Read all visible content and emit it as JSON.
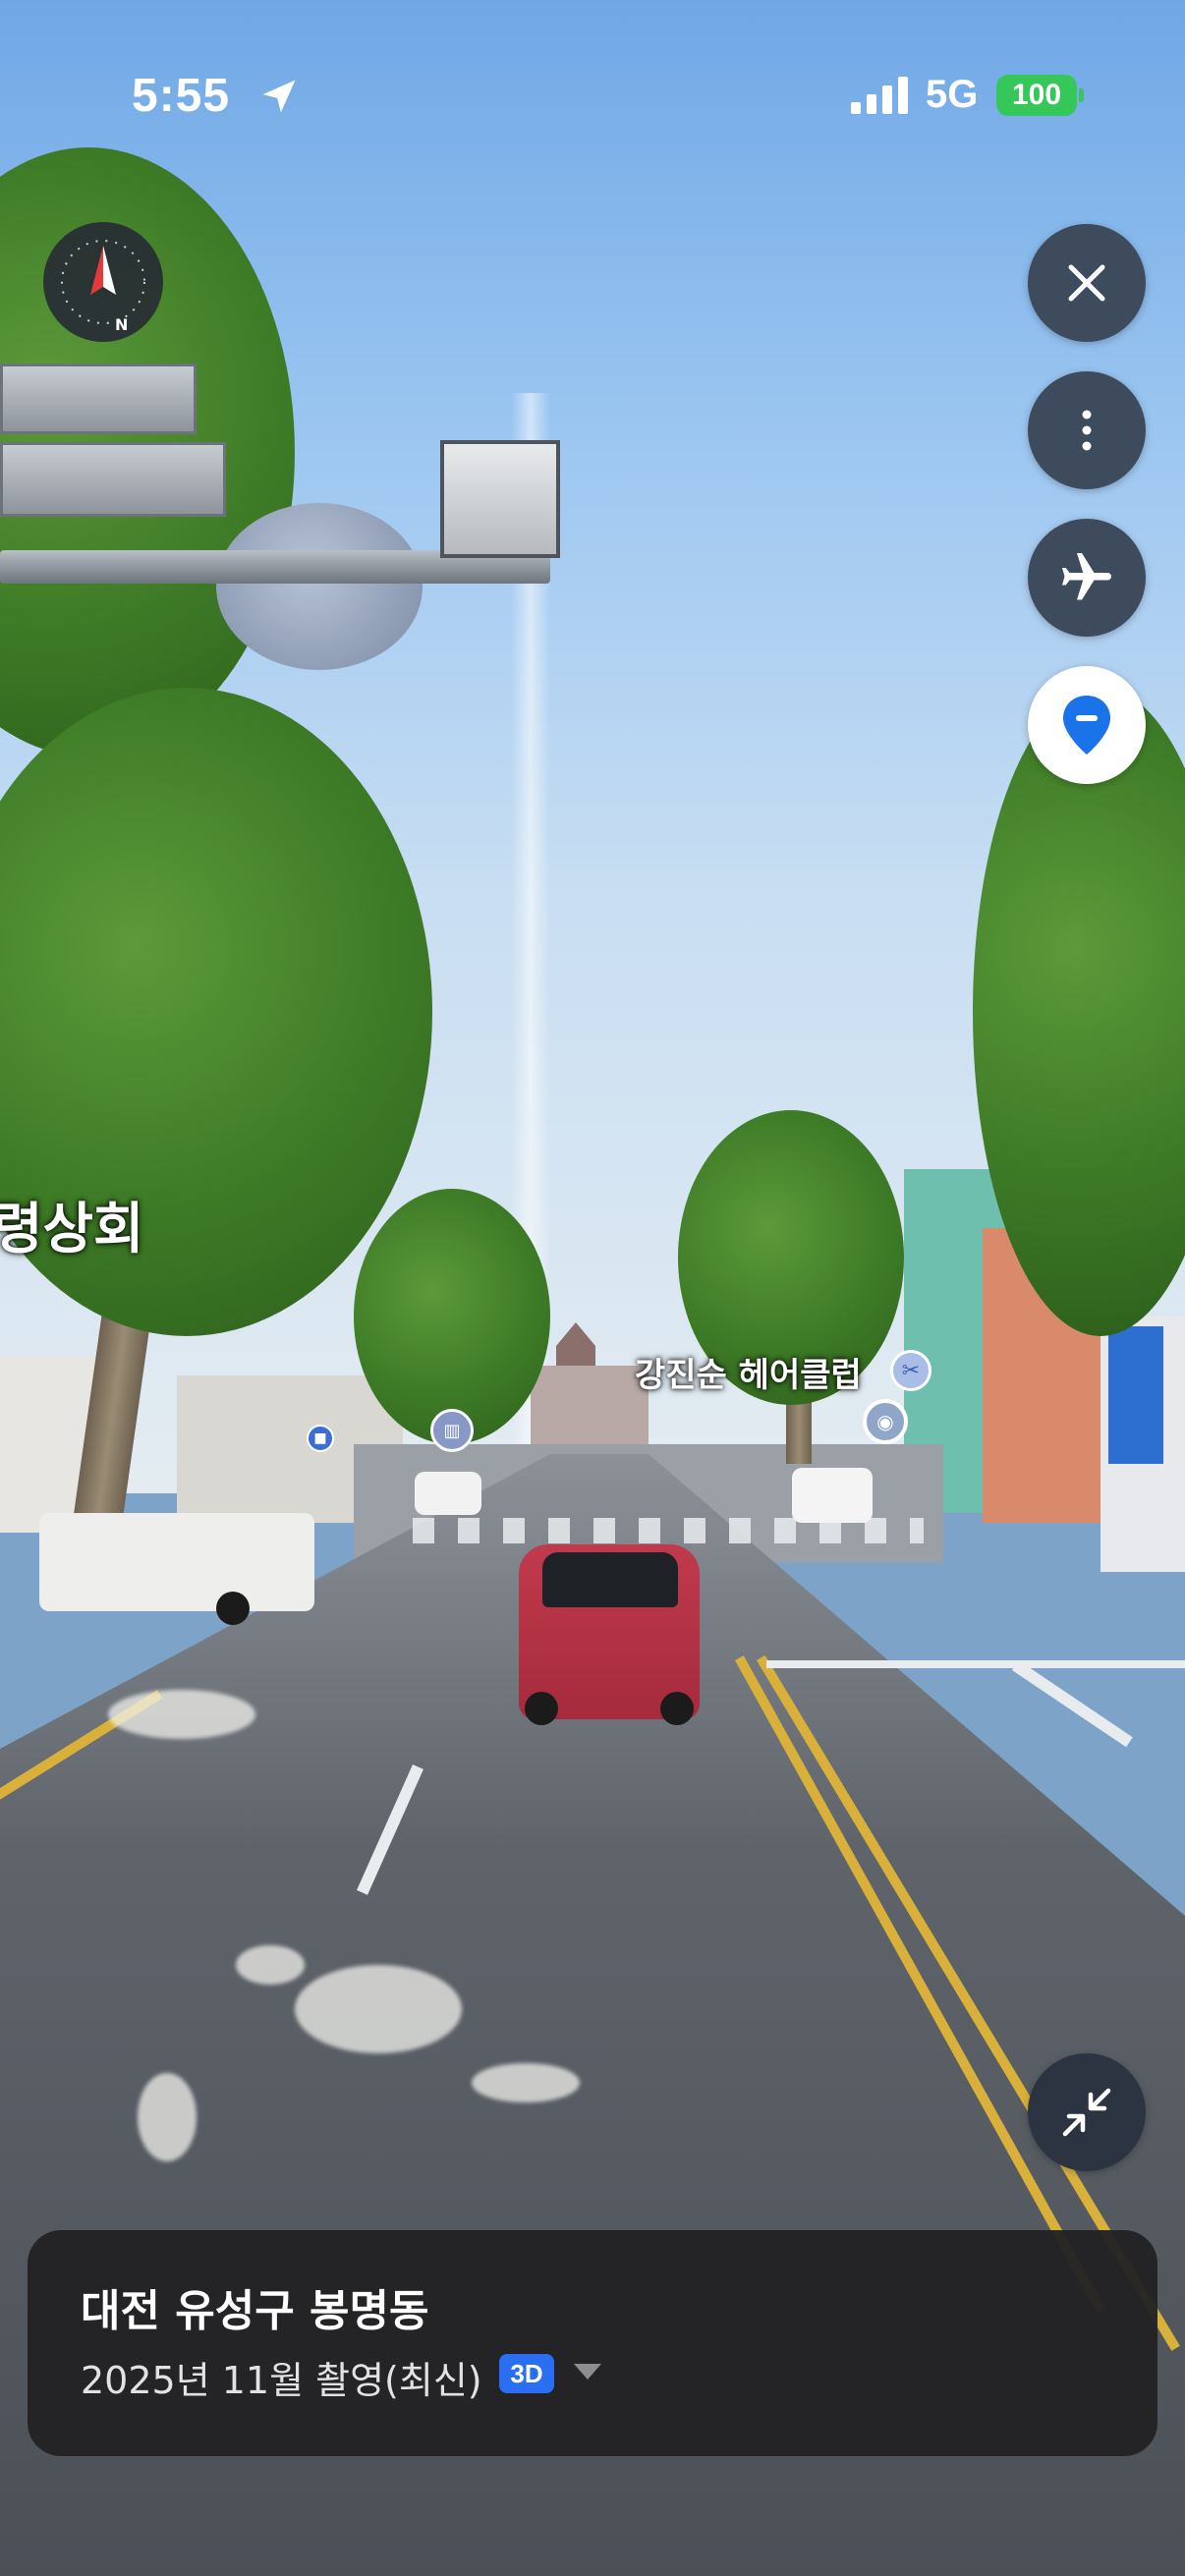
{
  "status_bar": {
    "time": "5:55",
    "network": "5G",
    "battery": "100",
    "location_icon": "location-arrow-icon",
    "signal_icon": "signal-bars-icon"
  },
  "compass": {
    "north_label": "N",
    "icon": "compass-icon"
  },
  "side_controls": [
    {
      "name": "close-button",
      "icon": "close-icon"
    },
    {
      "name": "more-options-button",
      "icon": "more-vertical-icon"
    },
    {
      "name": "airplane-view-button",
      "icon": "airplane-icon"
    },
    {
      "name": "location-pin-button",
      "icon": "map-pin-minus-icon"
    }
  ],
  "shrink_button": {
    "icon": "shrink-arrows-icon"
  },
  "map_labels": {
    "left_store": "령상회",
    "hair_salon": "강진순 헤어클럽"
  },
  "info_panel": {
    "location": "대전 유성구 봉명동",
    "capture_date": "2025년 11월 촬영(최신)",
    "badge": "3D"
  },
  "colors": {
    "button_dark": "#3e4b5c",
    "pin_blue": "#1a73e8",
    "badge_blue": "#2a6ff2",
    "battery_green": "#35c759",
    "panel_bg": "#222224"
  }
}
